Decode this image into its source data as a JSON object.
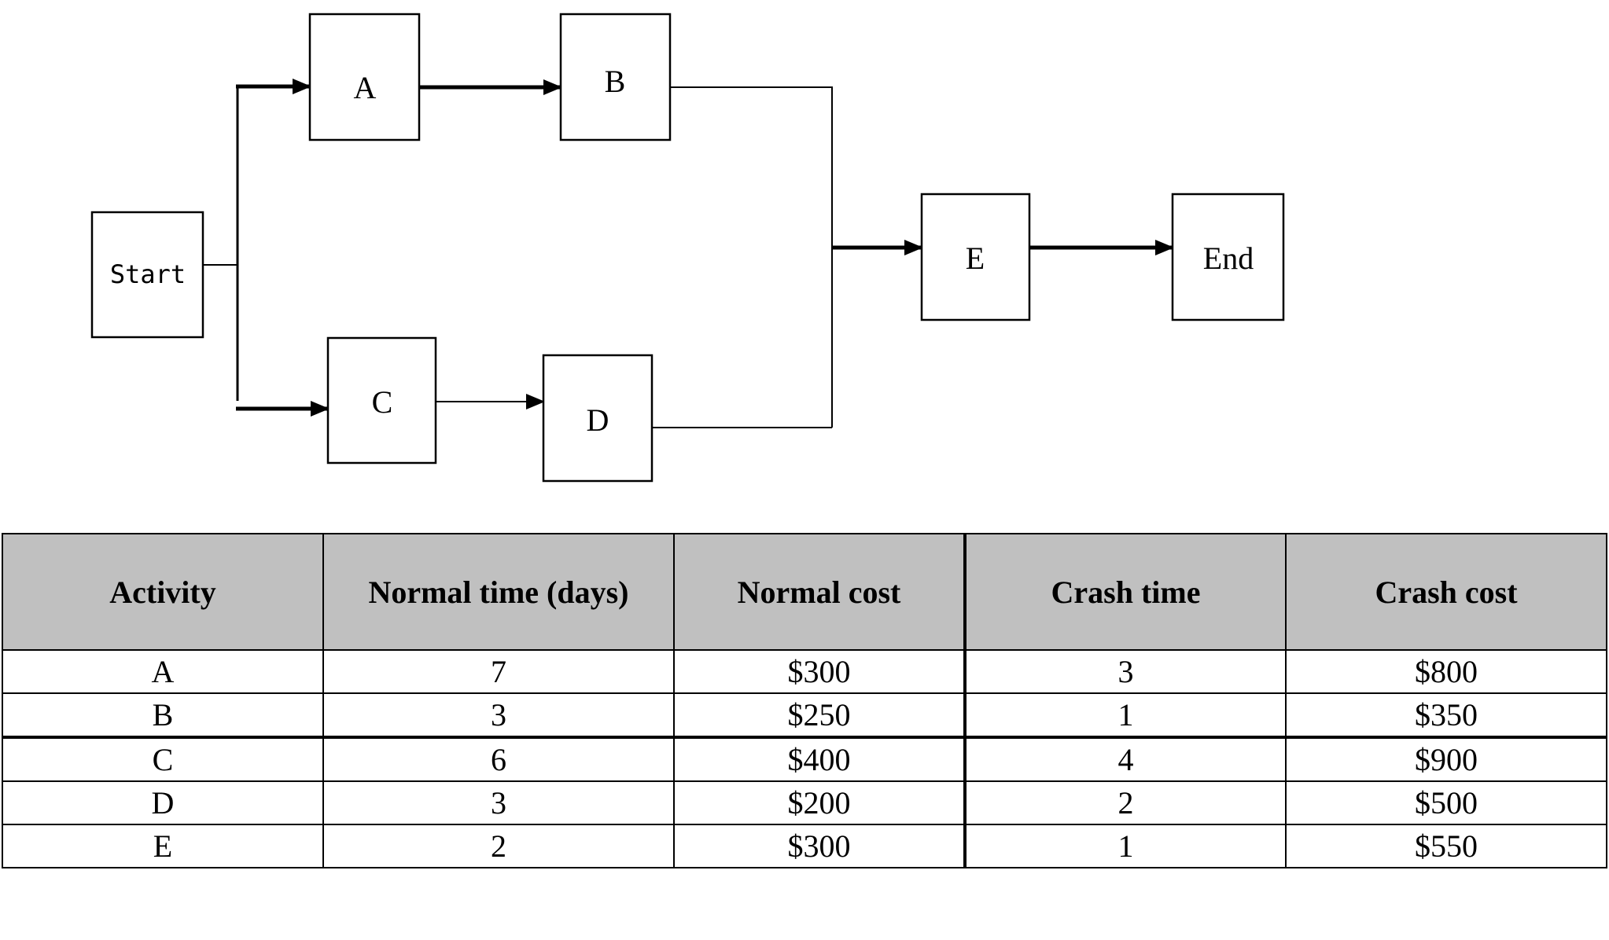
{
  "diagram": {
    "nodes": [
      {
        "id": "start",
        "label": "Start"
      },
      {
        "id": "a",
        "label": "A"
      },
      {
        "id": "b",
        "label": "B"
      },
      {
        "id": "c",
        "label": "C"
      },
      {
        "id": "d",
        "label": "D"
      },
      {
        "id": "e",
        "label": "E"
      },
      {
        "id": "end",
        "label": "End"
      }
    ],
    "edges": [
      {
        "from": "start",
        "to": "a"
      },
      {
        "from": "a",
        "to": "b"
      },
      {
        "from": "start",
        "to": "c"
      },
      {
        "from": "c",
        "to": "d"
      },
      {
        "from": "b",
        "to": "e"
      },
      {
        "from": "d",
        "to": "e"
      },
      {
        "from": "e",
        "to": "end"
      }
    ]
  },
  "table": {
    "headers": [
      "Activity",
      "Normal time (days)",
      "Normal cost",
      "Crash time",
      "Crash cost"
    ],
    "rows": [
      [
        "A",
        "7",
        "$300",
        "3",
        "$800"
      ],
      [
        "B",
        "3",
        "$250",
        "1",
        "$350"
      ],
      [
        "C",
        "6",
        "$400",
        "4",
        "$900"
      ],
      [
        "D",
        "3",
        "$200",
        "2",
        "$500"
      ],
      [
        "E",
        "2",
        "$300",
        "1",
        "$550"
      ]
    ]
  }
}
